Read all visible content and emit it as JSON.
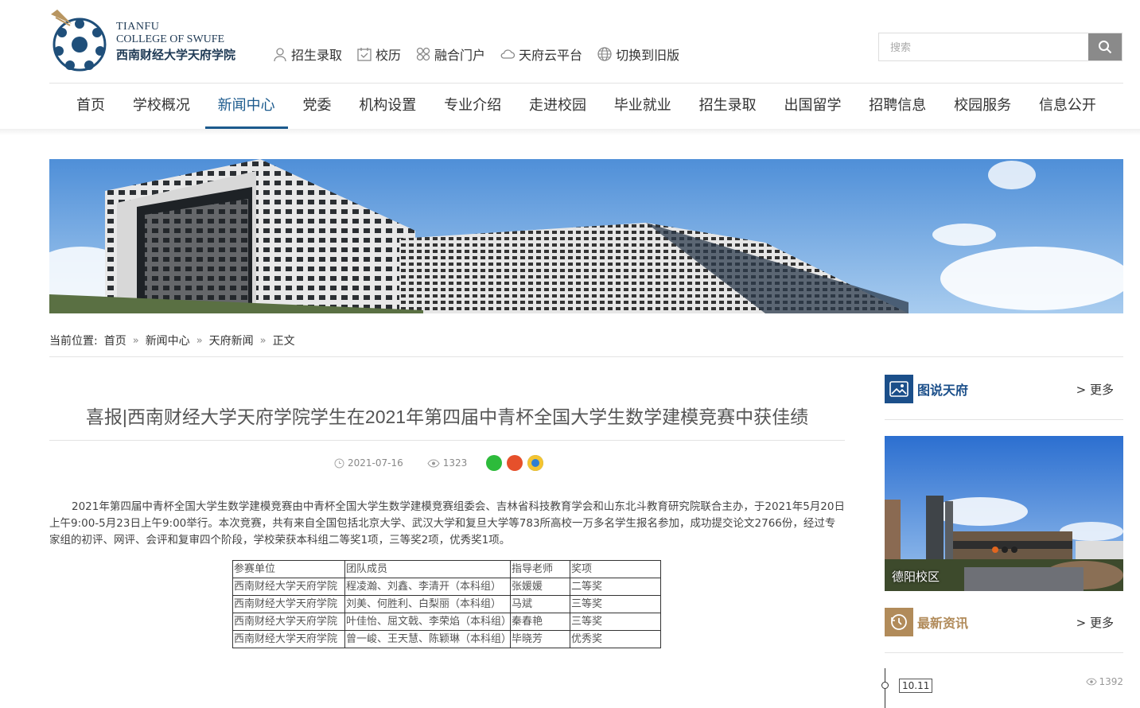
{
  "header": {
    "logo": {
      "line1": "TIANFU",
      "line2": "COLLEGE OF SWUFE",
      "line3": "西南财经大学天府学院"
    },
    "quick_links": [
      {
        "label": "招生录取",
        "icon": "user-icon"
      },
      {
        "label": "校历",
        "icon": "calendar-icon"
      },
      {
        "label": "融合门户",
        "icon": "portal-icon"
      },
      {
        "label": "天府云平台",
        "icon": "cloud-icon"
      },
      {
        "label": "切换到旧版",
        "icon": "globe-icon"
      }
    ],
    "search": {
      "placeholder": "搜索"
    }
  },
  "nav": {
    "items": [
      "首页",
      "学校概况",
      "新闻中心",
      "党委",
      "机构设置",
      "专业介绍",
      "走进校园",
      "毕业就业",
      "招生录取",
      "出国留学",
      "招聘信息",
      "校园服务",
      "信息公开"
    ],
    "active_index": 2
  },
  "breadcrumb": {
    "prefix": "当前位置:",
    "items": [
      "首页",
      "新闻中心",
      "天府新闻",
      "正文"
    ],
    "separator": "»"
  },
  "article": {
    "title": "喜报|西南财经大学天府学院学生在2021年第四届中青杯全国大学生数学建模竞赛中获佳绩",
    "date": "2021-07-16",
    "views": "1323",
    "body": "2021年第四届中青杯全国大学生数学建模竞赛由中青杯全国大学生数学建模竞赛组委会、吉林省科技教育学会和山东北斗教育研究院联合主办，于2021年5月20日上午9:00-5月23日上午9:00举行。本次竞赛，共有来自全国包括北京大学、武汉大学和复旦大学等783所高校一万多名学生报名参加，成功提交论文2766份，经过专家组的初评、网评、会评和复审四个阶段，学校荣获本科组二等奖1项，三等奖2项，优秀奖1项。",
    "table": {
      "headers": [
        "参赛单位",
        "团队成员",
        "指导老师",
        "奖项"
      ],
      "rows": [
        [
          "西南财经大学天府学院",
          "程凌瀚、刘鑫、李清开（本科组）",
          "张媛媛",
          "二等奖"
        ],
        [
          "西南财经大学天府学院",
          "刘美、何胜利、白梨丽（本科组）",
          "马斌",
          "三等奖"
        ],
        [
          "西南财经大学天府学院",
          "叶佳怡、屈文戟、李荣焰（本科组）",
          "秦春艳",
          "三等奖"
        ],
        [
          "西南财经大学天府学院",
          "曾一峻、王天慧、陈颖琳（本科组）",
          "毕晓芳",
          "优秀奖"
        ]
      ]
    }
  },
  "sidebar": {
    "pictures": {
      "title": "图说天府",
      "more": "> 更多",
      "caption": "德阳校区",
      "accent": "#1b4f8a"
    },
    "news": {
      "title": "最新资讯",
      "more": "> 更多",
      "accent": "#b18b5a",
      "first": {
        "date": "10.11",
        "views": "1392"
      }
    }
  },
  "colors": {
    "brand": "#1b5a8d",
    "gold": "#b18b5a"
  }
}
